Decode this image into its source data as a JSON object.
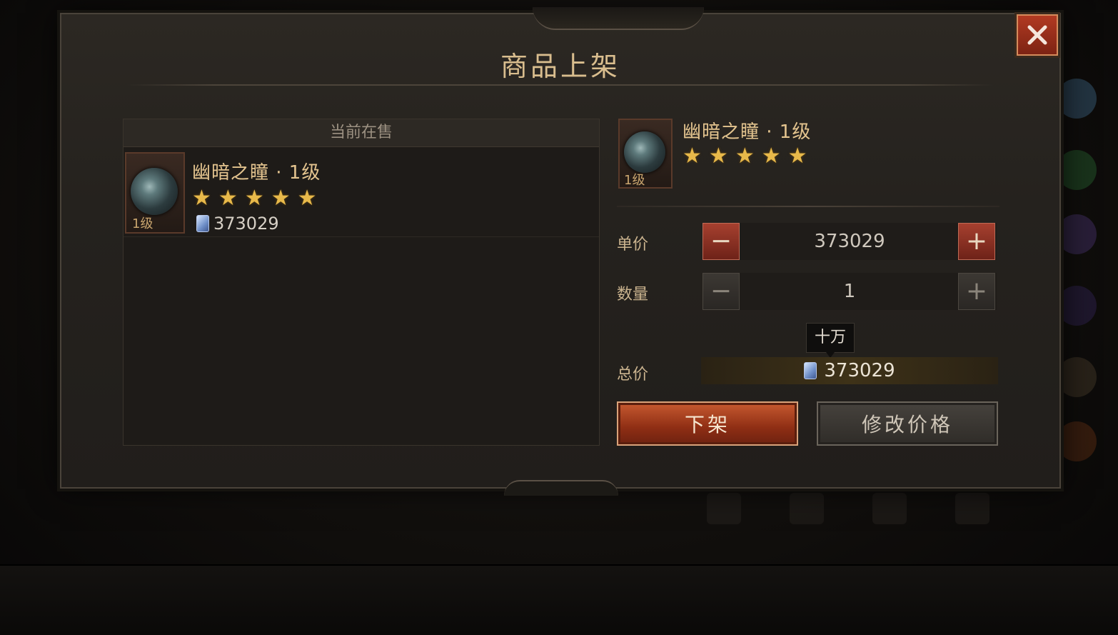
{
  "dialog": {
    "title": "商品上架",
    "close_icon": "close-icon"
  },
  "current_sale": {
    "header": "当前在售",
    "listing": {
      "icon": "dark-eye-orb-icon",
      "level_tag": "1级",
      "name": "幽暗之瞳 · 1级",
      "stars": [
        "★",
        "★",
        "★",
        "★",
        "★"
      ],
      "currency_icon": "gem-icon",
      "price": "373029"
    }
  },
  "detail": {
    "item": {
      "icon": "dark-eye-orb-icon",
      "level_tag": "1级",
      "name": "幽暗之瞳 · 1级",
      "stars": [
        "★",
        "★",
        "★",
        "★",
        "★"
      ]
    },
    "unit_price": {
      "label": "单价",
      "value": "373029",
      "minus": "−",
      "plus": "+"
    },
    "quantity": {
      "label": "数量",
      "value": "1",
      "minus": "−",
      "plus": "+"
    },
    "magnitude_tooltip": "十万",
    "total": {
      "label": "总价",
      "currency_icon": "gem-icon",
      "value": "373029"
    },
    "buttons": {
      "delist": "下架",
      "modify_price": "修改价格"
    }
  },
  "colors": {
    "accent_gold": "#d9bd8e",
    "star": "#e8b94a",
    "primary_button": "#8f2e14"
  }
}
